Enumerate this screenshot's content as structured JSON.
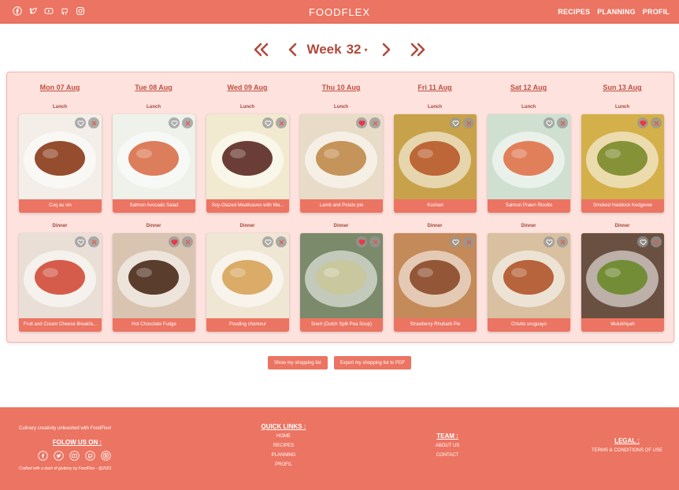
{
  "header": {
    "brand": "FOODFLEX",
    "social_icons": [
      "facebook-icon",
      "twitter-icon",
      "youtube-icon",
      "github-icon",
      "instagram-icon"
    ],
    "nav": [
      "RECIPES",
      "PLANNING",
      "PROFIL"
    ]
  },
  "week": {
    "label": "Week",
    "number": "32",
    "selector_glyph": "▾"
  },
  "days": [
    {
      "label": "Mon 07 Aug"
    },
    {
      "label": "Tue 08 Aug"
    },
    {
      "label": "Wed 09 Aug"
    },
    {
      "label": "Thu 10 Aug"
    },
    {
      "label": "Fri 11 Aug"
    },
    {
      "label": "Sat 12 Aug"
    },
    {
      "label": "Sun 13 Aug"
    }
  ],
  "meals": {
    "lunch_label": "Lunch",
    "dinner_label": "Dinner",
    "lunch": [
      {
        "title": "Coq au vin",
        "favorite": false
      },
      {
        "title": "Salmon Avocado Salad",
        "favorite": false
      },
      {
        "title": "Soy-Glazed Meatloaves with Wa...",
        "favorite": false
      },
      {
        "title": "Lamb and Potato pie",
        "favorite": true
      },
      {
        "title": "Koshari",
        "favorite": false
      },
      {
        "title": "Salmon Prawn Risotto",
        "favorite": false
      },
      {
        "title": "Smoked Haddock Kedgeree",
        "favorite": true
      }
    ],
    "dinner": [
      {
        "title": "Fruit and Cream Cheese Breakfa...",
        "favorite": false
      },
      {
        "title": "Hot Chocolate Fudge",
        "favorite": true
      },
      {
        "title": "Pouding chomeur",
        "favorite": false
      },
      {
        "title": "Snert (Dutch Split Pea Soup)",
        "favorite": true
      },
      {
        "title": "Strawberry Rhubarb Pie",
        "favorite": false
      },
      {
        "title": "Chivito uruguayo",
        "favorite": false
      },
      {
        "title": "Mulukhiyah",
        "favorite": false
      }
    ]
  },
  "actions": {
    "show_list": "Show my shopping list",
    "export_list": "Export my shopping list to PDF"
  },
  "footer": {
    "tagline": "Culinary creativity unleashed with FoodFlex!",
    "follow_heading": "FOLOW US ON :",
    "credit": "Crafted with a dash of gluttony by FoodFlex - @2023",
    "quick_links_heading": "QUICK LINKS :",
    "quick_links": [
      "HOME",
      "RECIPES",
      "PLANNING",
      "PROFIL"
    ],
    "team_heading": "TEAM :",
    "team_links": [
      "ABOUT US",
      "CONTACT"
    ],
    "legal_heading": "LEGAL :",
    "legal_links": [
      "TERMS & CONDITIONS OF USE"
    ]
  },
  "colors": {
    "brand": "#ec7462",
    "panel_bg": "#fde2de",
    "accent_text": "#b04a3c"
  }
}
